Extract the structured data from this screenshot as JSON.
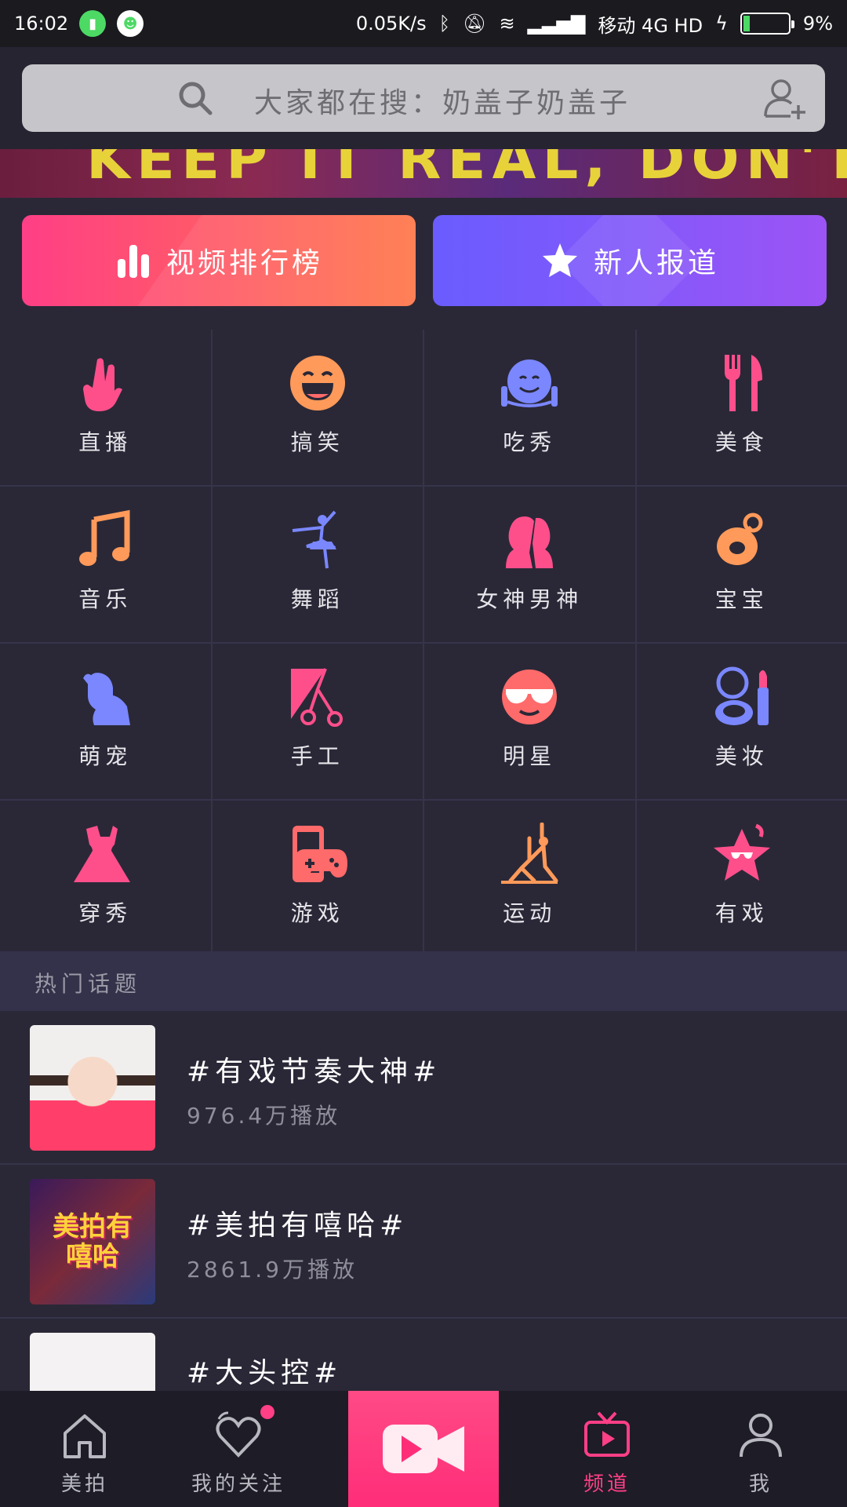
{
  "status_bar": {
    "time": "16:02",
    "network_speed": "0.05K/s",
    "carrier": "移动 4G HD",
    "battery": "9%"
  },
  "search": {
    "placeholder": "大家都在搜：奶盖子奶盖子"
  },
  "banner": {
    "text": "KEEP IT REAL, DON'T STOP"
  },
  "features": {
    "rank_label": "视频排行榜",
    "new_label": "新人报道"
  },
  "categories": [
    {
      "label": "直播",
      "icon": "rock-hand-icon",
      "color": "#ff4f8b"
    },
    {
      "label": "搞笑",
      "icon": "laughing-face-icon",
      "color": "#ff9a5a"
    },
    {
      "label": "吃秀",
      "icon": "eating-face-icon",
      "color": "#7a87ff"
    },
    {
      "label": "美食",
      "icon": "fork-knife-icon",
      "color": "#ff4f8b"
    },
    {
      "label": "音乐",
      "icon": "music-note-icon",
      "color": "#ff9a5a"
    },
    {
      "label": "舞蹈",
      "icon": "ballet-dancer-icon",
      "color": "#7a87ff"
    },
    {
      "label": "女神男神",
      "icon": "couple-silhouette-icon",
      "color": "#ff4f8b"
    },
    {
      "label": "宝宝",
      "icon": "pacifier-icon",
      "color": "#ff9a5a"
    },
    {
      "label": "萌宠",
      "icon": "pets-icon",
      "color": "#7a87ff"
    },
    {
      "label": "手工",
      "icon": "scissors-icon",
      "color": "#ff4f8b"
    },
    {
      "label": "明星",
      "icon": "sunglasses-icon",
      "color": "#ff6a6a"
    },
    {
      "label": "美妆",
      "icon": "makeup-icon",
      "color": "#7a87ff"
    },
    {
      "label": "穿秀",
      "icon": "dress-icon",
      "color": "#ff4f8b"
    },
    {
      "label": "游戏",
      "icon": "gamepad-icon",
      "color": "#ff6a6a"
    },
    {
      "label": "运动",
      "icon": "yoga-icon",
      "color": "#ff9a5a"
    },
    {
      "label": "有戏",
      "icon": "star-face-icon",
      "color": "#ff4f8b"
    }
  ],
  "hot_topics": {
    "title": "热门话题",
    "items": [
      {
        "name": "#有戏节奏大神#",
        "plays": "976.4万播放"
      },
      {
        "name": "#美拍有嘻哈#",
        "plays": "2861.9万播放",
        "thumb_text": "美拍有嘻哈"
      },
      {
        "name": "#大头控#",
        "plays": ""
      }
    ]
  },
  "tabbar": {
    "home": "美拍",
    "following": "我的关注",
    "channel": "频道",
    "me": "我"
  },
  "colors": {
    "accent": "#ff3f86",
    "background": "#2a2837"
  }
}
